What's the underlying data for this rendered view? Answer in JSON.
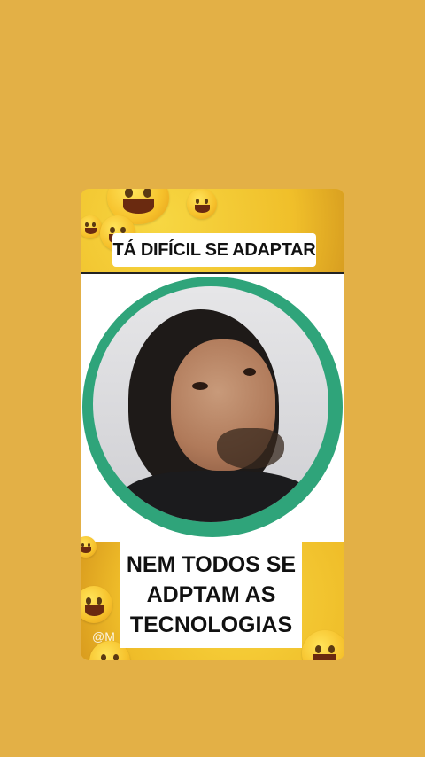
{
  "caption_top": "TÁ DIFÍCIL SE ADAPTAR",
  "caption_bottom": {
    "line1": "NEM TODOS SE",
    "line2": "ADPTAM AS",
    "line3": "TECNOLOGIAS"
  },
  "watermark": "@M",
  "colors": {
    "background": "#e3b046",
    "ring": "#2fa47a",
    "caption_bg": "#ffffff"
  },
  "icons": [
    "laughing-emoji-icon",
    "smiling-emoji-icon"
  ]
}
